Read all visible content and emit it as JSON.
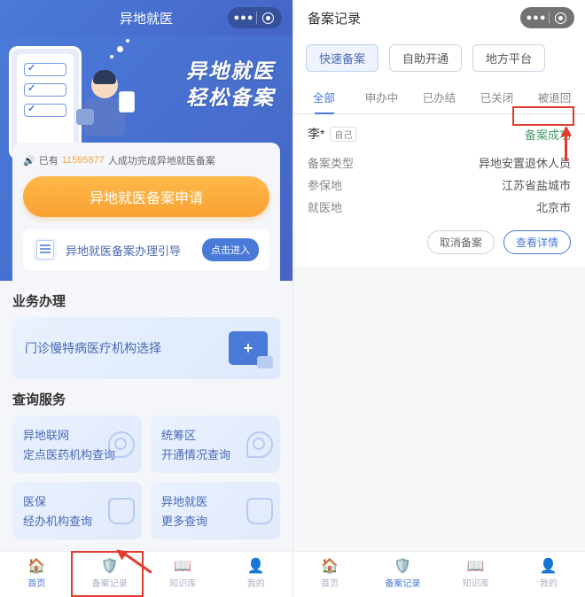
{
  "left": {
    "title": "异地就医",
    "slogan1": "异地就医",
    "slogan2": "轻松备案",
    "stat_prefix": "已有",
    "stat_count": "11595877",
    "stat_suffix": "人成功完成异地就医备案",
    "big_btn": "异地就医备案申请",
    "guide_label": "异地就医备案办理引导",
    "guide_btn": "点击进入",
    "sec1_title": "业务办理",
    "sec1_card": "门诊慢特病医疗机构选择",
    "sec2_title": "查询服务",
    "q": [
      {
        "l1": "异地联网",
        "l2": "定点医药机构查询"
      },
      {
        "l1": "统筹区",
        "l2": "开通情况查询"
      },
      {
        "l1": "医保",
        "l2": "经办机构查询"
      },
      {
        "l1": "异地就医",
        "l2": "更多查询"
      }
    ],
    "tabs": [
      "首页",
      "备案记录",
      "知识库",
      "我的"
    ]
  },
  "right": {
    "title": "备案记录",
    "pills": [
      "快速备案",
      "自助开通",
      "地方平台"
    ],
    "tabs": [
      "全部",
      "申办中",
      "已办结",
      "已关闭",
      "被退回"
    ],
    "record": {
      "name": "李*",
      "tag": "自己",
      "status": "备案成功",
      "kv": [
        {
          "k": "备案类型",
          "v": "异地安置退休人员"
        },
        {
          "k": "参保地",
          "v": "江苏省盐城市"
        },
        {
          "k": "就医地",
          "v": "北京市"
        }
      ],
      "actions": [
        "取消备案",
        "查看详情"
      ]
    },
    "tabs_bottom": [
      "首页",
      "备案记录",
      "知识库",
      "我的"
    ]
  }
}
